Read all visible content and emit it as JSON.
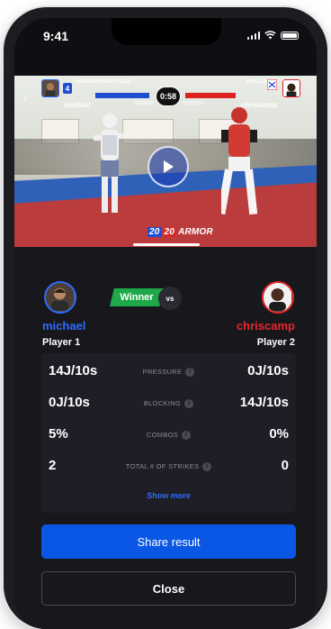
{
  "status": {
    "time": "9:41"
  },
  "scoreboard": {
    "left_club": "ARMOR2020 FIGHT CLUB",
    "right_club": "KTA CLUB",
    "left_name": "michael",
    "right_name": "chriscamp",
    "left_score": "0008000",
    "right_score": "0002500",
    "timer": "0:58",
    "left_seed": "4"
  },
  "video": {
    "watermark_blue": "20",
    "watermark_red": "20",
    "watermark_word": "ARMOR"
  },
  "result": {
    "winner_label": "Winner",
    "vs_label": "vs",
    "player1": {
      "name": "michael",
      "label": "Player 1"
    },
    "player2": {
      "name": "chriscamp",
      "label": "Player 2"
    }
  },
  "stats": [
    {
      "label": "PRESSURE",
      "left": "14J/10s",
      "right": "0J/10s"
    },
    {
      "label": "BLOCKING",
      "left": "0J/10s",
      "right": "14J/10s"
    },
    {
      "label": "COMBOS",
      "left": "5%",
      "right": "0%"
    },
    {
      "label": "TOTAL # OF STRIKES",
      "left": "2",
      "right": "0"
    }
  ],
  "actions": {
    "show_more": "Show more",
    "share": "Share result",
    "close": "Close"
  },
  "colors": {
    "blue": "#2f6bff",
    "red": "#e8272b",
    "winner_green": "#1fa84a",
    "share_blue": "#0a57e6",
    "background": "#17171c"
  }
}
